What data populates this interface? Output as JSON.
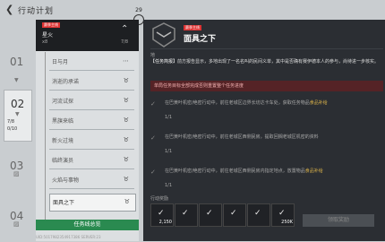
{
  "header": {
    "title": "行动计划",
    "back_icon": "back-arrow-icon"
  },
  "panel_indicator": {
    "number": "29"
  },
  "chapters": [
    {
      "n": "01",
      "state": "open"
    },
    {
      "n": "02",
      "state": "active",
      "sub1": "7/8",
      "sub2": "0/10"
    },
    {
      "n": "03",
      "state": "locked"
    },
    {
      "n": "04",
      "state": "locked"
    }
  ],
  "task_panel": {
    "head": {
      "tag": "赛季主线",
      "name": "星火",
      "count": "x8",
      "progress": "7/8"
    },
    "items": [
      {
        "label": "日与月",
        "state": "normal"
      },
      {
        "label": "消逝的承诺",
        "state": "normal"
      },
      {
        "label": "河流试探",
        "state": "normal"
      },
      {
        "label": "黑旗来临",
        "state": "normal"
      },
      {
        "label": "新火过境",
        "state": "normal"
      },
      {
        "label": "临终演员",
        "state": "normal"
      },
      {
        "label": "火焰与事物",
        "state": "normal"
      },
      {
        "label": "面具之下",
        "state": "selected"
      }
    ],
    "bottom_tab": "任务线总览"
  },
  "detail": {
    "tag": "赛季主线",
    "title": "面具之下",
    "label": "地",
    "summary_title": "【任务简报】",
    "summary_text": "前方报告显示，多地出现了一名名叫的民间义单，其中是否确有赛伊德本人的参与，尚待进一步核实。",
    "warning": "单局任务目标全部完成否则重置整个任务进度",
    "objectives": [
      {
        "text": "在巴黄叶机密/绝密行动中，前往老城区边界长坊达卡车处，获取任务物品",
        "link": "食品补给",
        "count": "1/1"
      },
      {
        "text": "在巴黄叶机密/绝密行动中，前往老城区西侧民房，提取回搁老城区机密的资料",
        "link": "",
        "count": "1/1"
      },
      {
        "text": "在巴黄叶机密/绝密行动中，前往老城区西侧民房内指定地点，放置物品",
        "link": "食品补给",
        "count": "1/1"
      }
    ],
    "reward_label": "行动奖励",
    "rewards": [
      {
        "qty": "2,150"
      },
      {
        "qty": ""
      },
      {
        "qty": ""
      },
      {
        "qty": ""
      },
      {
        "qty": ""
      },
      {
        "qty": "250K"
      }
    ],
    "claim_button": "领取奖励"
  },
  "footer": "UID:5017982354917386 SERVER:23"
}
